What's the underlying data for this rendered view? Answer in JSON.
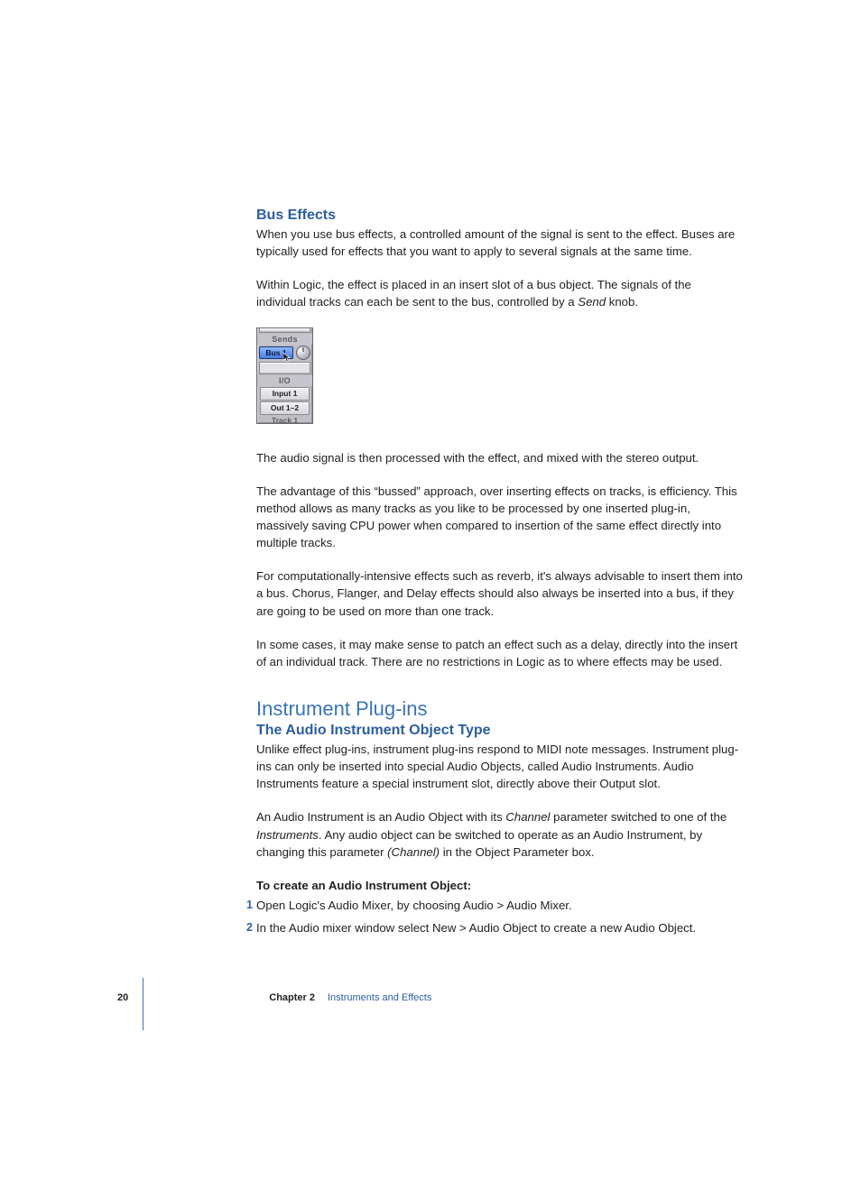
{
  "section1": {
    "heading": "Bus Effects",
    "p1": "When you use bus effects, a controlled amount of the signal is sent to the effect. Buses are typically used for effects that you want to apply to several signals at the same time.",
    "p2a": "Within Logic, the effect is placed in an insert slot of a bus object. The signals of the individual tracks can each be sent to the bus, controlled by a ",
    "p2_em": "Send",
    "p2b": " knob.",
    "fig": {
      "sends": "Sends",
      "bus": "Bus 1",
      "io": "I/O",
      "input": "Input 1",
      "output": "Out 1–2",
      "track": "Track 1"
    },
    "p3": "The audio signal is then processed with the effect, and mixed with the stereo output.",
    "p4": "The advantage of this “bussed” approach, over inserting effects on tracks, is efficiency. This method allows as many tracks as you like to be processed by one inserted plug-in, massively saving CPU power when compared to insertion of the same effect directly into multiple tracks.",
    "p5": "For computationally-intensive effects such as reverb, it's always advisable to insert them into a bus. Chorus, Flanger, and Delay effects should also always be inserted into a bus, if they are going to be used on more than one track.",
    "p6": "In some cases, it may make sense to patch an effect such as a delay, directly into the insert of an individual track. There are no restrictions in Logic as to where effects may be used."
  },
  "section2": {
    "heading": "Instrument Plug-ins",
    "subheading": "The Audio Instrument Object Type",
    "p1": "Unlike effect plug-ins, instrument plug-ins respond to MIDI note messages. Instrument plug-ins can only be inserted into special Audio Objects, called Audio Instruments. Audio Instruments feature a special instrument slot, directly above their Output slot.",
    "p2a": "An Audio Instrument is an Audio Object with its ",
    "p2_em1": "Channel",
    "p2b": " parameter switched to one of the ",
    "p2_em2": "Instruments",
    "p2c": ". Any audio object can be switched to operate as an Audio Instrument, by changing this parameter ",
    "p2_em3": "(Channel)",
    "p2d": " in the Object Parameter box.",
    "steps_heading": "To create an Audio Instrument Object:",
    "steps": [
      "Open Logic's Audio Mixer, by choosing Audio > Audio Mixer.",
      "In the Audio mixer window select New > Audio Object to create a new Audio Object."
    ]
  },
  "footer": {
    "page": "20",
    "chapter": "Chapter 2",
    "title": "Instruments and Effects"
  }
}
